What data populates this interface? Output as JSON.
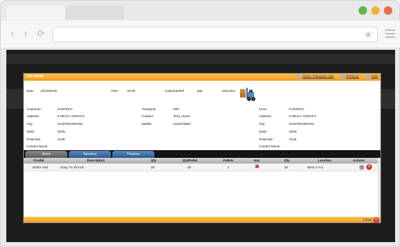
{
  "browser": {
    "dots": [
      "#62b547",
      "#f0b43b",
      "#ea6a47"
    ],
    "back_icon": "‹",
    "forward_icon": "›",
    "reload_icon": "⟳",
    "star_icon": "★"
  },
  "modal": {
    "title": "Job Detail",
    "links": {
      "open_transport_job": "Open Transport Job",
      "print_list": "PrintList",
      "edit": "Edit"
    },
    "header": {
      "date_label": "Date",
      "date_value": "01/04/2015",
      "time_label": "Time",
      "time_value": "10:00",
      "customer_ref_label": "CustomerRef",
      "customer_ref_value": "jakj",
      "direction_label": "Direction"
    },
    "customer": {
      "customer_label": "Customer:",
      "customer_value": "FANTECH",
      "address_label": "Address:",
      "address_value": "8 HEALY CIRCUIT,",
      "city_label": "City:",
      "city_value": "HUNTINGWOOD",
      "state_label": "State:",
      "state_value": "NSW",
      "postcode_label": "Postcode:",
      "postcode_value": "2148",
      "contact_label": "Contact Name:"
    },
    "transport": {
      "transport_label": "Transport:",
      "transport_value": "KBT",
      "contact_label": "Contact:",
      "contact_value": "Terry Jones",
      "mobile_label": "Mobile:",
      "mobile_value": "0411875667"
    },
    "from": {
      "from_label": "From:",
      "from_value": "FANTECH",
      "address_label": "Address:",
      "address_value": "8 HEALY CIRCUIT,",
      "city_label": "City:",
      "city_value": "HUNTINGWOOD",
      "state_label": "State:",
      "state_value": "NSW",
      "postcode_label": "Postcode:",
      "postcode_value": "2148",
      "contact_label": "Contact Name:"
    },
    "tabs": [
      "Items",
      "Services",
      "Finance"
    ],
    "grid": {
      "columns": [
        "ProdId",
        "Description",
        "Qty",
        "Qty/Pallet",
        "Pallets",
        "Haz",
        "Qty",
        "Location",
        "Actions"
      ],
      "row": {
        "prodid": "SONY A45",
        "description": "Sony TV 45 inch",
        "qty": "20",
        "qty_pallet": "20",
        "pallets": "1",
        "haz": "✖",
        "qty2": "20",
        "location": "WH1-1-A-1"
      }
    },
    "footer": {
      "close_label": "Close"
    }
  }
}
